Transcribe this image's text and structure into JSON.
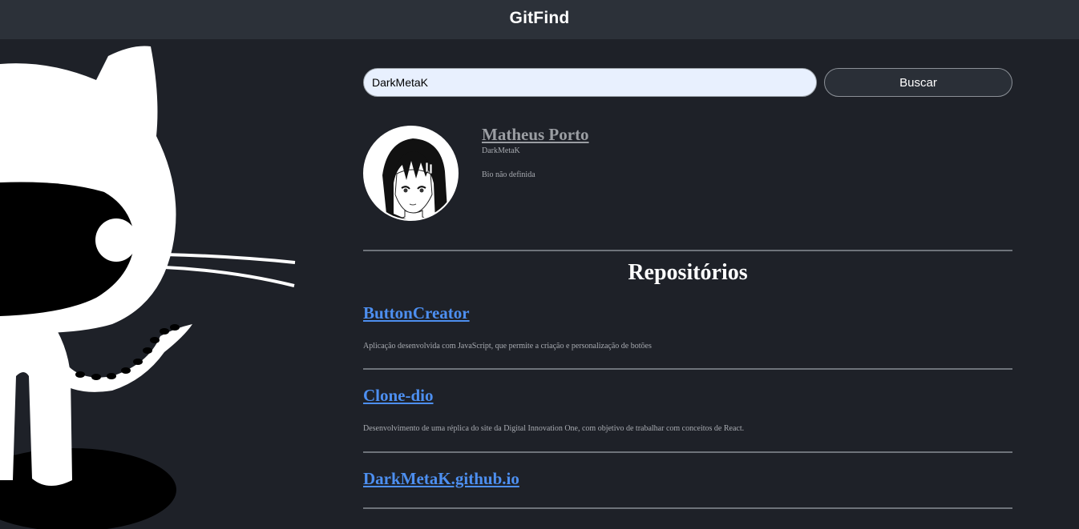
{
  "header": {
    "title": "GitFind"
  },
  "search": {
    "value": "DarkMetaK",
    "button_label": "Buscar"
  },
  "profile": {
    "name": "Matheus Porto",
    "login": "DarkMetaK",
    "bio": "Bio não definida"
  },
  "repos": {
    "title": "Repositórios",
    "items": [
      {
        "name": "ButtonCreator",
        "description": "Aplicação desenvolvida com JavaScript, que permite a criação e personalização de botões"
      },
      {
        "name": "Clone-dio",
        "description": "Desenvolvimento de uma réplica do site da Digital Innovation One, com objetivo de trabalhar com conceitos de React."
      },
      {
        "name": "DarkMetaK.github.io",
        "description": ""
      }
    ]
  },
  "colors": {
    "background": "#1e2128",
    "header": "#2c3139",
    "link": "#4d8ff0",
    "input": "#e8f0fe"
  }
}
